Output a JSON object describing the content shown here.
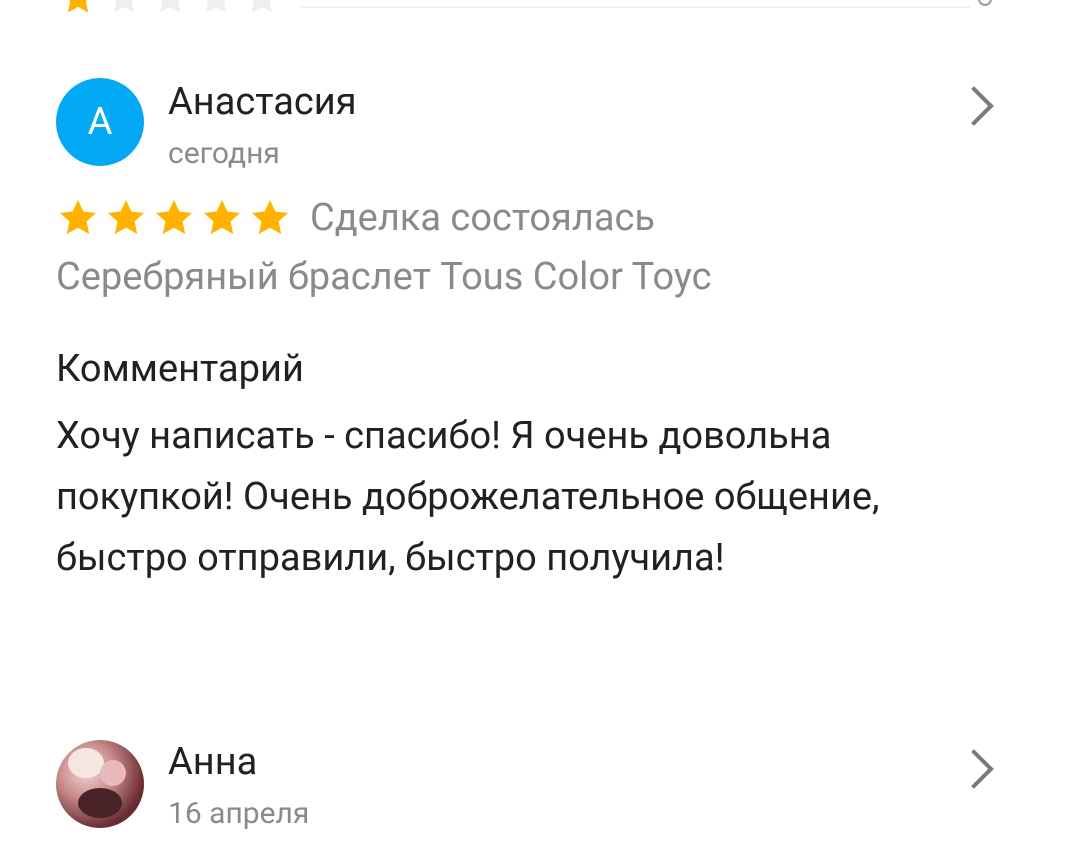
{
  "colors": {
    "star_filled": "#ffb300",
    "star_empty": "#eeeeee",
    "avatar_bg": "#03a9f4",
    "secondary_text": "#8a8a8a",
    "primary_text": "#212121"
  },
  "previous_review": {
    "rating": 1,
    "max_rating": 5
  },
  "reviews": [
    {
      "avatar_letter": "А",
      "author": "Анастасия",
      "date": "сегодня",
      "rating": 5,
      "max_rating": 5,
      "deal_status": "Сделка состоялась",
      "item_title": "Серебряный браслет Tous Color Toyc",
      "comment_heading": "Комментарий",
      "comment_text": "Хочу написать - спасибо! Я очень довольна покупкой! Очень доброжелательное общение, быстро отправили, быстро получила!"
    },
    {
      "avatar_icon": "user-photo",
      "author": "Анна",
      "date": "16 апреля"
    }
  ],
  "icons": {
    "open_review": "chevron-right-icon",
    "rating_star": "star-icon"
  }
}
